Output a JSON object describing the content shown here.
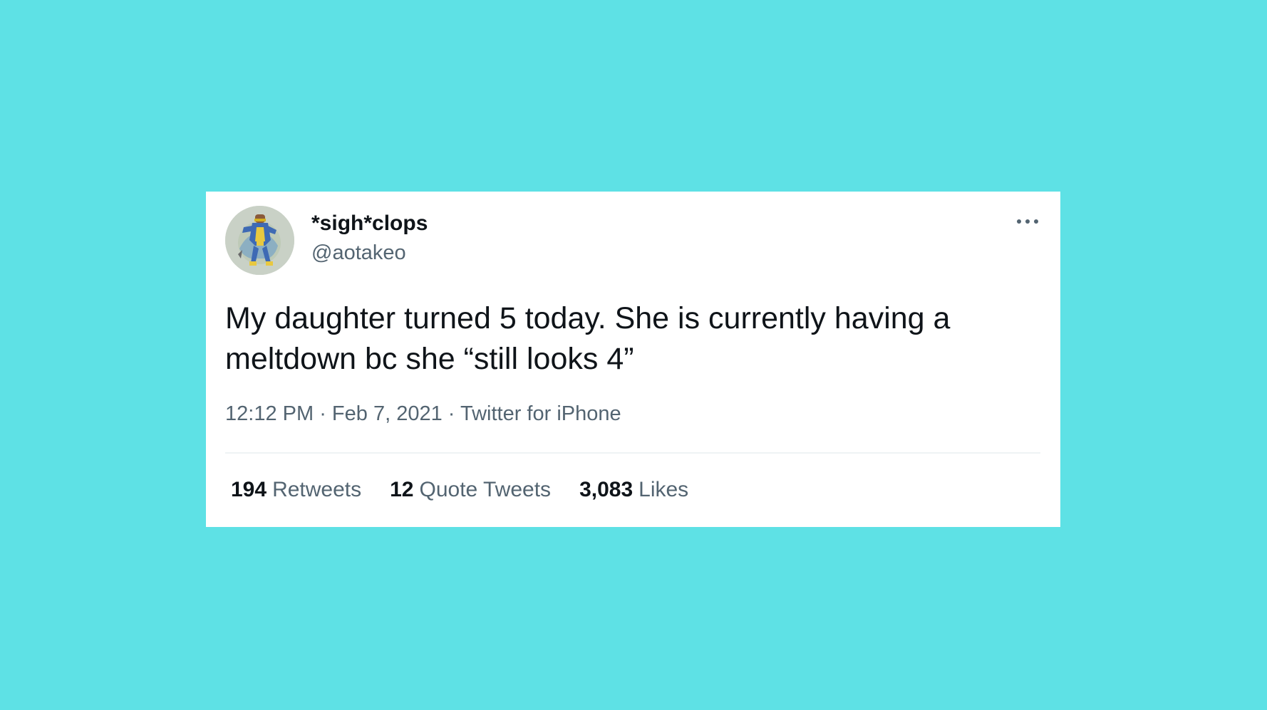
{
  "colors": {
    "background": "#5ee1e5",
    "card": "#ffffff",
    "text_primary": "#0f1419",
    "text_secondary": "#536471"
  },
  "tweet": {
    "author": {
      "display_name": "*sigh*clops",
      "handle": "@aotakeo",
      "avatar_icon": "cyclops-illustration-avatar"
    },
    "more_icon": "more-horizontal-icon",
    "text": "My daughter turned 5 today. She is currently having a meltdown bc she “still looks 4”",
    "meta": {
      "time": "12:12 PM",
      "separator": " · ",
      "date": "Feb 7, 2021",
      "source": "Twitter for iPhone"
    },
    "stats": {
      "retweets": {
        "count": "194",
        "label": "Retweets"
      },
      "quote_tweets": {
        "count": "12",
        "label": "Quote Tweets"
      },
      "likes": {
        "count": "3,083",
        "label": "Likes"
      }
    }
  }
}
